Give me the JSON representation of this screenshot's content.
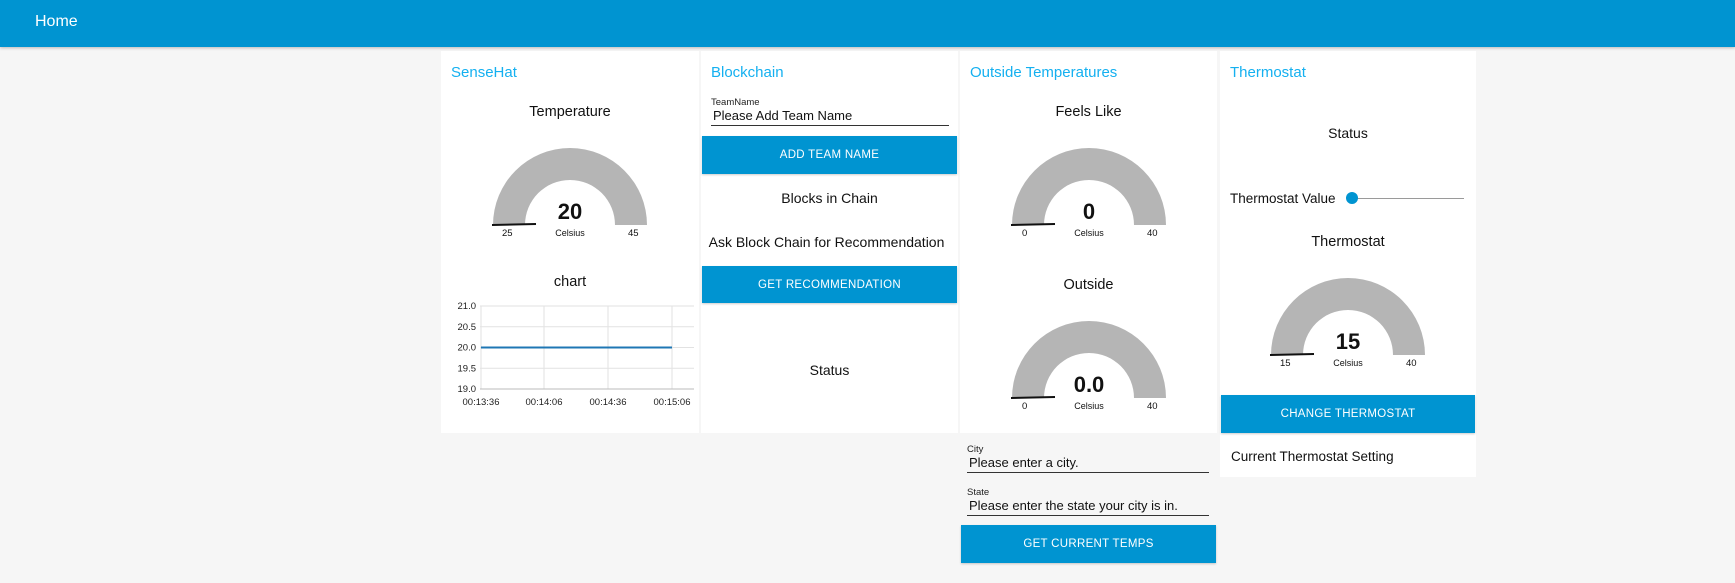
{
  "header": {
    "title": "Home"
  },
  "colors": {
    "accent": "#0094d1",
    "group_title": "#14b0f0",
    "gauge_fill": "#b5b5b5",
    "line": "#1f77b4"
  },
  "sensehat": {
    "title": "SenseHat",
    "gauge": {
      "label": "Temperature",
      "value": "20",
      "units": "Celsius",
      "min": "25",
      "max": "45"
    },
    "chart": {
      "label": "chart",
      "y_ticks": [
        "21.0",
        "20.5",
        "20.0",
        "19.5",
        "19.0"
      ],
      "x_ticks": [
        "00:13:36",
        "00:14:06",
        "00:14:36",
        "00:15:06"
      ]
    }
  },
  "chart_data": {
    "type": "line",
    "title": "chart",
    "x": [
      "00:13:36",
      "00:14:06",
      "00:14:36",
      "00:15:06"
    ],
    "series": [
      {
        "values": [
          20.0,
          20.0,
          20.0,
          20.0
        ]
      }
    ],
    "ylim": [
      19.0,
      21.0
    ],
    "grid": true
  },
  "blockchain": {
    "title": "Blockchain",
    "team_field": {
      "label": "TeamName",
      "value": "Please Add Team Name"
    },
    "add_button": "ADD TEAM NAME",
    "blocks_text": "Blocks in Chain",
    "ask_text": "Ask Block Chain for Recommendation",
    "rec_button": "GET RECOMMENDATION",
    "status_text": "Status"
  },
  "outside": {
    "title": "Outside Temperatures",
    "feels": {
      "label": "Feels Like",
      "value": "0",
      "units": "Celsius",
      "min": "0",
      "max": "40"
    },
    "outside": {
      "label": "Outside",
      "value": "0.0",
      "units": "Celsius",
      "min": "0",
      "max": "40"
    },
    "city_field": {
      "label": "City",
      "value": "Please enter a city."
    },
    "state_field": {
      "label": "State",
      "value": "Please enter the state your city is in."
    },
    "temps_button": "GET CURRENT TEMPS"
  },
  "thermostat": {
    "title": "Thermostat",
    "status_text": "Status",
    "slider": {
      "label": "Thermostat Value",
      "level": 0
    },
    "gauge": {
      "label": "Thermostat",
      "value": "15",
      "units": "Celsius",
      "min": "15",
      "max": "40"
    },
    "change_button": "CHANGE THERMOSTAT",
    "setting_text": "Current Thermostat Setting"
  }
}
